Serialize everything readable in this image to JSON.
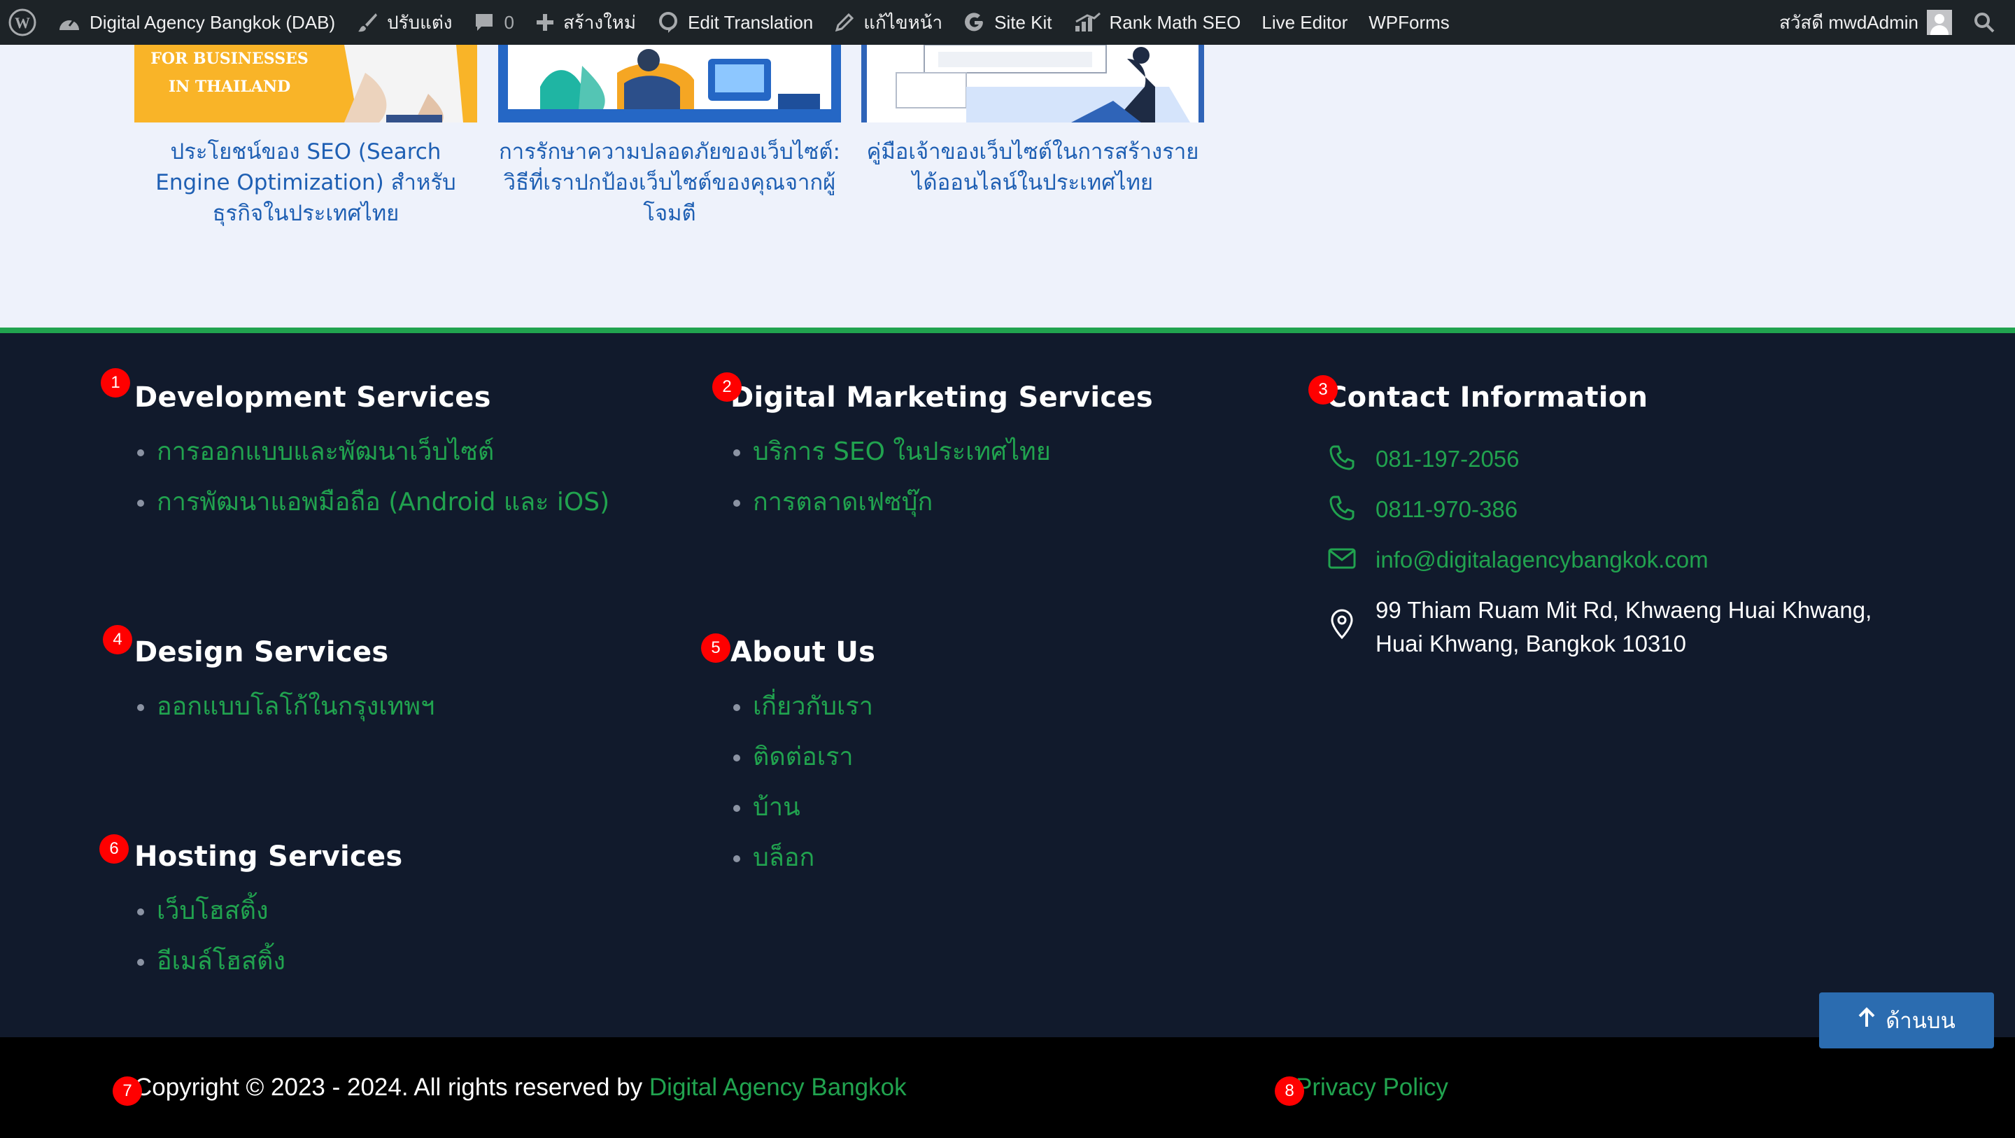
{
  "admin_bar": {
    "site_name": "Digital Agency Bangkok (DAB)",
    "customize": "ปรับแต่ง",
    "comments_count": "0",
    "new": "สร้างใหม่",
    "edit_translation": "Edit Translation",
    "edit_page": "แก้ไขหน้า",
    "site_kit": "Site Kit",
    "rank_math": "Rank Math SEO",
    "live_editor": "Live Editor",
    "wpforms": "WPForms",
    "greeting": "สวัสดี mwdAdmin"
  },
  "related_posts": [
    {
      "title": "ประโยชน์ของ SEO (Search Engine Optimization) สำหรับธุรกิจในประเทศไทย",
      "thumb_text": "FOR BUSINESSES IN THAILAND"
    },
    {
      "title": "การรักษาความปลอดภัยของเว็บไซต์: วิธีที่เราปกป้องเว็บไซต์ของคุณจากผู้โจมตี"
    },
    {
      "title": "คู่มือเจ้าของเว็บไซต์ในการสร้างรายได้ออนไลน์ในประเทศไทย"
    }
  ],
  "footer": {
    "development": {
      "badge": "1",
      "title": "Development Services",
      "links": [
        "การออกแบบและพัฒนาเว็บไซต์",
        "การพัฒนาแอพมือถือ (Android และ iOS)"
      ]
    },
    "marketing": {
      "badge": "2",
      "title": "Digital Marketing Services",
      "links": [
        "บริการ SEO ในประเทศไทย",
        "การตลาดเฟซบุ๊ก"
      ]
    },
    "contact": {
      "badge": "3",
      "title": "Contact Information",
      "phone1": "081-197-2056",
      "phone2": "0811-970-386",
      "email": "info@digitalagencybangkok.com",
      "address_line1": "99 Thiam Ruam Mit Rd, Khwaeng Huai Khwang,",
      "address_line2": "Huai Khwang, Bangkok 10310"
    },
    "design": {
      "badge": "4",
      "title": "Design Services",
      "links": [
        "ออกแบบโลโก้ในกรุงเทพฯ"
      ]
    },
    "about": {
      "badge": "5",
      "title": "About Us",
      "links": [
        "เกี่ยวกับเรา",
        "ติดต่อเรา",
        "บ้าน",
        "บล็อก"
      ]
    },
    "hosting": {
      "badge": "6",
      "title": "Hosting Services",
      "links": [
        "เว็บโฮสติ้ง",
        "อีเมล์โฮสติ้ง"
      ]
    }
  },
  "bottom_bar": {
    "badge_copyright": "7",
    "copyright_prefix": "Copyright © 2023 - 2024. All rights reserved by ",
    "copyright_link": "Digital Agency Bangkok",
    "badge_privacy": "8",
    "privacy": "Privacy Policy"
  },
  "back_to_top": "ด้านบน",
  "colors": {
    "accent_green": "#21a34f",
    "footer_bg": "#111a2c",
    "link_blue": "#1e5fb3",
    "button_blue": "#2b6cb0",
    "badge_red": "#ff0000"
  }
}
